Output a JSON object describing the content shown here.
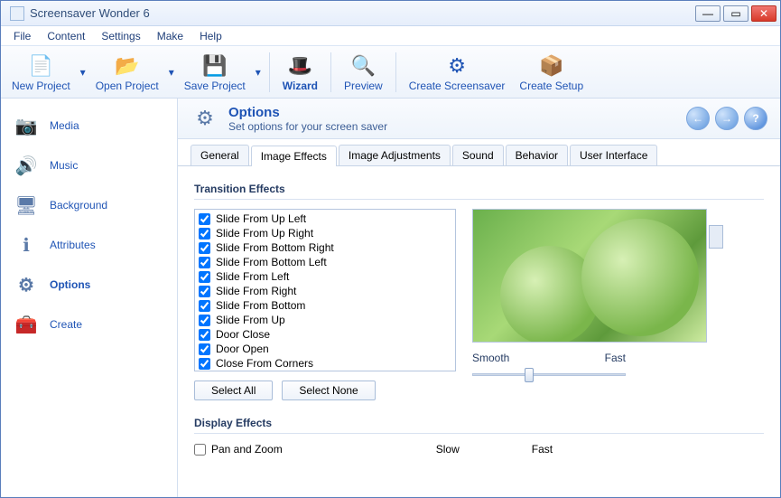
{
  "window": {
    "title": "Screensaver Wonder 6"
  },
  "menu": [
    "File",
    "Content",
    "Settings",
    "Make",
    "Help"
  ],
  "toolbar": [
    {
      "label": "New Project",
      "icon": "📄",
      "dd": true
    },
    {
      "label": "Open Project",
      "icon": "📂",
      "dd": true
    },
    {
      "label": "Save Project",
      "icon": "💾",
      "dd": true
    },
    {
      "label": "Wizard",
      "icon": "🎩",
      "strong": true,
      "sepBefore": true
    },
    {
      "label": "Preview",
      "icon": "🔍",
      "sepBefore": true
    },
    {
      "label": "Create Screensaver",
      "icon": "⚙",
      "sepBefore": true
    },
    {
      "label": "Create Setup",
      "icon": "📦"
    }
  ],
  "sidebar": [
    {
      "label": "Media",
      "icon": "📷"
    },
    {
      "label": "Music",
      "icon": "🔊"
    },
    {
      "label": "Background",
      "icon": "🖥"
    },
    {
      "label": "Attributes",
      "icon": "ℹ"
    },
    {
      "label": "Options",
      "icon": "⚙",
      "active": true
    },
    {
      "label": "Create",
      "icon": "🧰"
    }
  ],
  "header": {
    "title": "Options",
    "subtitle": "Set options for your screen saver"
  },
  "tabs": [
    "General",
    "Image Effects",
    "Image Adjustments",
    "Sound",
    "Behavior",
    "User Interface"
  ],
  "activeTab": "Image Effects",
  "sections": {
    "transition": "Transition Effects",
    "display": "Display Effects"
  },
  "effects": [
    "Slide From Up Left",
    "Slide From Up Right",
    "Slide From Bottom Right",
    "Slide From Bottom Left",
    "Slide From Left",
    "Slide From Right",
    "Slide From Bottom",
    "Slide From Up",
    "Door Close",
    "Door Open",
    "Close From Corners"
  ],
  "buttons": {
    "selectAll": "Select All",
    "selectNone": "Select None"
  },
  "slider": {
    "left": "Smooth",
    "right": "Fast"
  },
  "displayEffects": {
    "panZoom": "Pan and Zoom",
    "slow": "Slow",
    "fast": "Fast"
  }
}
